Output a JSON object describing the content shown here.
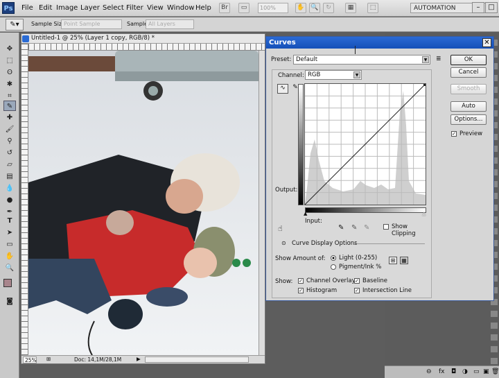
{
  "app": {
    "logo": "Ps"
  },
  "menu": [
    "File",
    "Edit",
    "Image",
    "Layer",
    "Select",
    "Filter",
    "View",
    "Window",
    "Help"
  ],
  "toolbar": {
    "zoom": "100%",
    "workspace": "AUTOMATION"
  },
  "options": {
    "sample_size_label": "Sample Size:",
    "sample_size_value": "Point Sample",
    "sample_label": "Sample:",
    "sample_value": "All Layers"
  },
  "document": {
    "title": "Untitled-1 @ 25% (Layer 1 copy, RGB/8) *",
    "zoom": "25%",
    "doc_info": "Doc: 14,1M/28,1M"
  },
  "curves": {
    "title": "Curves",
    "preset_label": "Preset:",
    "preset_value": "Default",
    "channel_label": "Channel:",
    "channel_value": "RGB",
    "output_label": "Output:",
    "input_label": "Input:",
    "show_clipping": "Show Clipping",
    "display_options": "Curve Display Options",
    "show_amount_label": "Show Amount of:",
    "light_option": "Light  (0-255)",
    "pigment_option": "Pigment/Ink %",
    "show_label": "Show:",
    "channel_overlays": "Channel Overlays",
    "baseline": "Baseline",
    "histogram": "Histogram",
    "intersection_line": "Intersection Line",
    "buttons": {
      "ok": "OK",
      "cancel": "Cancel",
      "smooth": "Smooth",
      "auto": "Auto",
      "options": "Options..."
    },
    "preview": "Preview",
    "preview_checked": true,
    "light_selected": true
  },
  "colors": {
    "accent": "#1a5cc8",
    "foreground_swatch": "#a8858c",
    "background_swatch": "#000000"
  }
}
